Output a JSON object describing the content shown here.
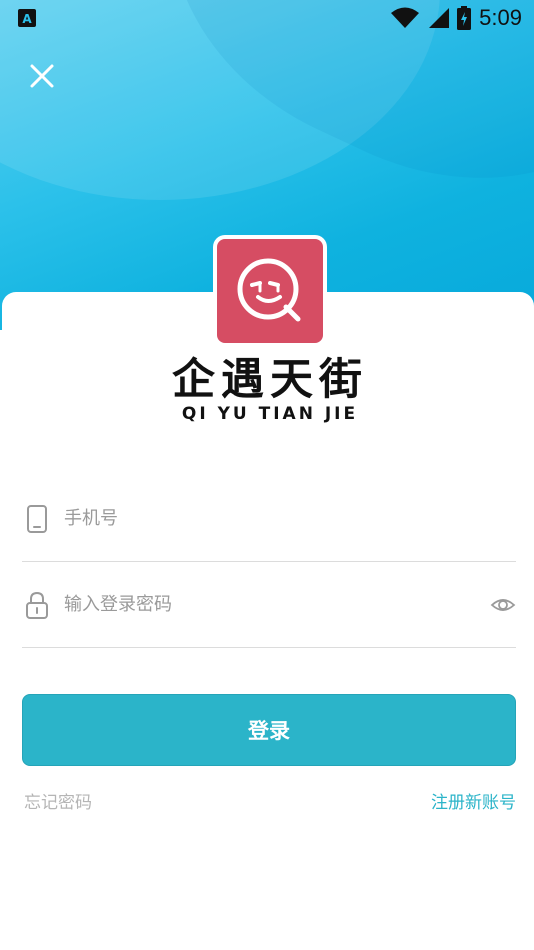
{
  "status_bar": {
    "time": "5:09",
    "app_icon_letter": "A",
    "icons": [
      "wifi-icon",
      "signal-icon",
      "battery-icon"
    ]
  },
  "brand": {
    "name_cn": "企遇天街",
    "name_pinyin": "QI YU TIAN JIE",
    "logo_icon": "smiley-face-icon"
  },
  "form": {
    "phone_placeholder": "手机号",
    "phone_value": "",
    "password_placeholder": "输入登录密码",
    "password_value": "",
    "login_label": "登录",
    "forgot_label": "忘记密码",
    "register_label": "注册新账号"
  },
  "colors": {
    "accent": "#2bb4c9",
    "logo": "#d64d63",
    "hero": "#07a9db"
  }
}
